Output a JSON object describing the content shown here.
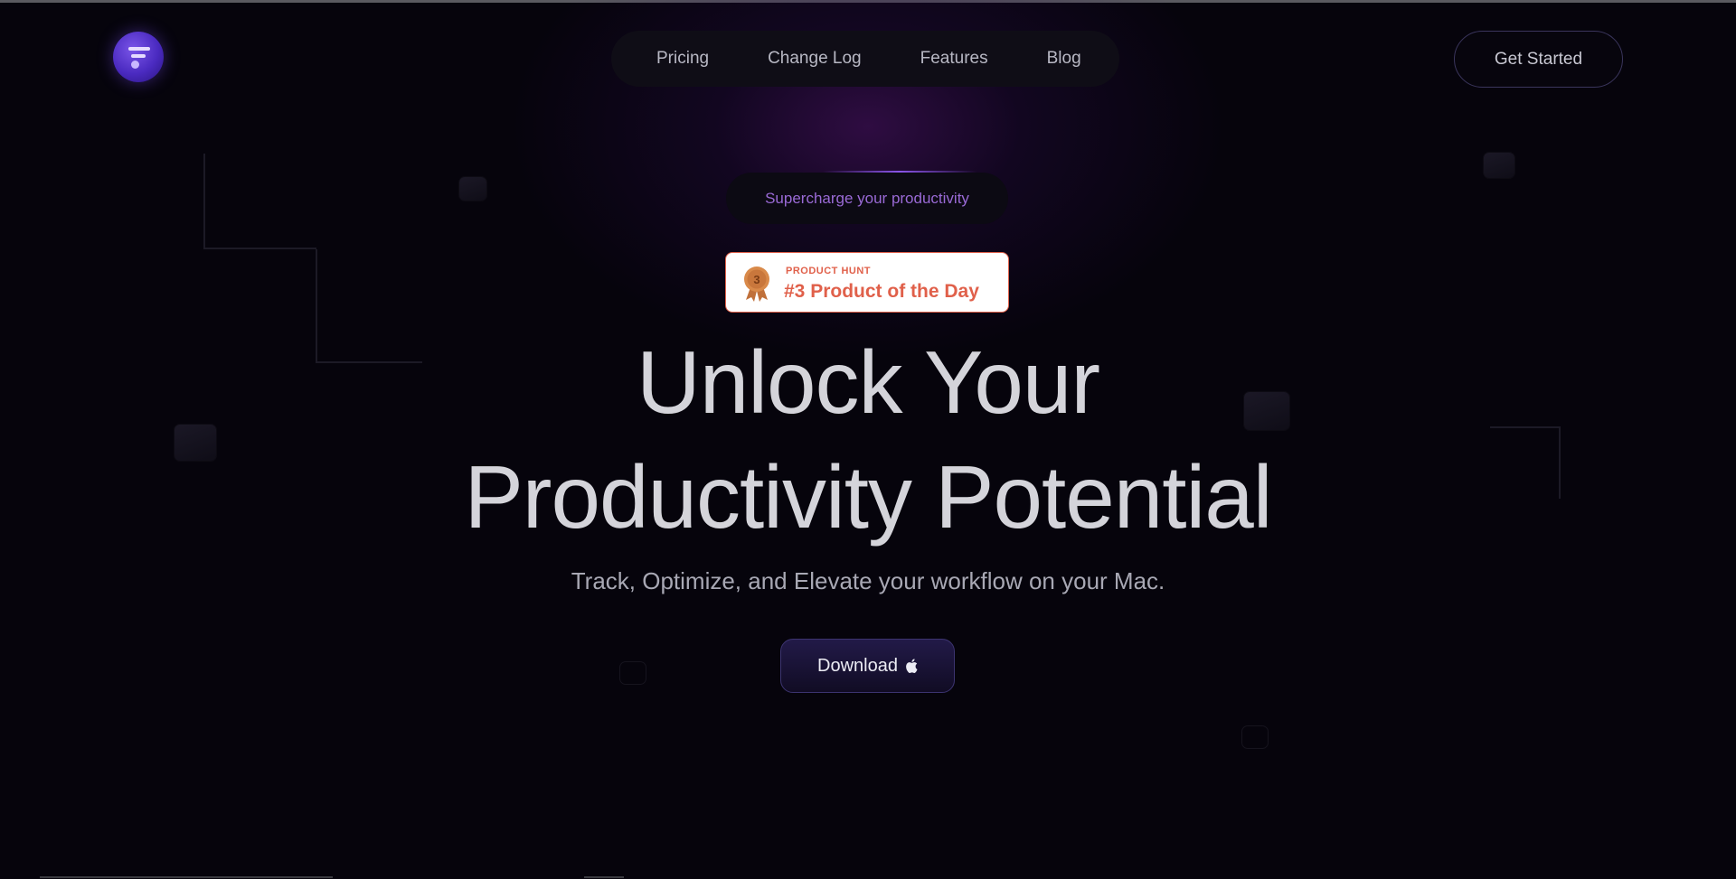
{
  "header": {
    "logo_name": "app-logo",
    "nav": [
      {
        "label": "Pricing"
      },
      {
        "label": "Change Log"
      },
      {
        "label": "Features"
      },
      {
        "label": "Blog"
      }
    ],
    "cta_label": "Get Started"
  },
  "hero": {
    "tagline": "Supercharge your productivity",
    "badge": {
      "source": "PRODUCT HUNT",
      "title": "#3 Product of the Day",
      "rank": "3"
    },
    "title_line1": "Unlock Your",
    "title_line2": "Productivity Potential",
    "subtitle": "Track, Optimize, and Elevate your workflow on your Mac.",
    "download_label": "Download",
    "download_icon": "apple-icon"
  },
  "colors": {
    "background": "#06040c",
    "accent": "#7a55e8",
    "badge_red": "#e0604a",
    "tagline_purple": "#9a6ad6"
  }
}
